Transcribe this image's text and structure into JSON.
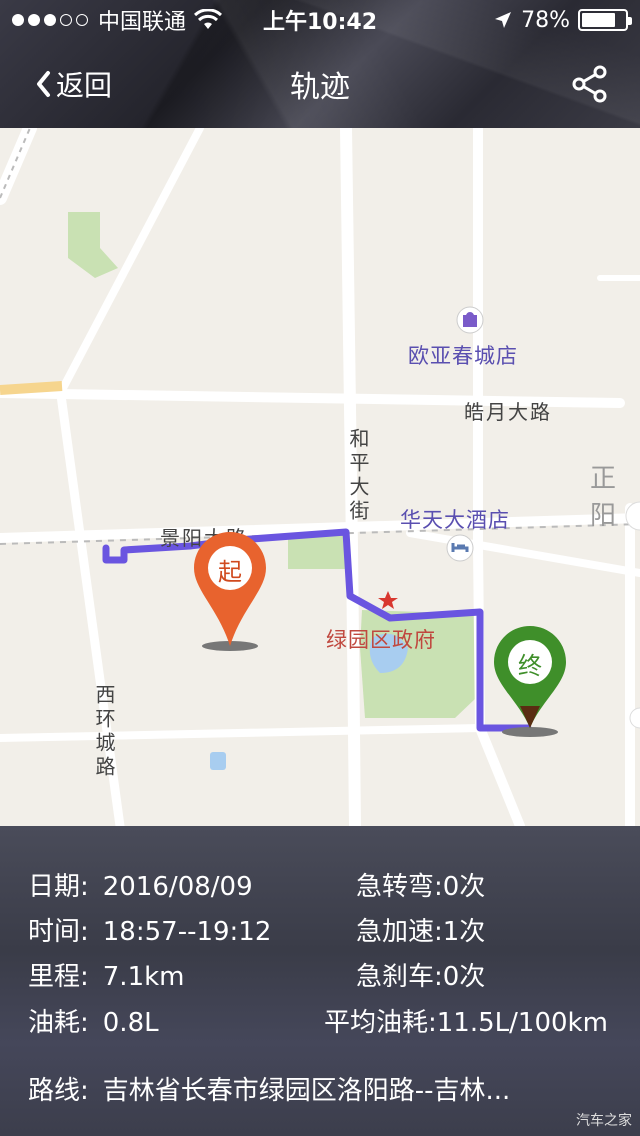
{
  "status_bar": {
    "carrier": "中国联通",
    "time": "上午10:42",
    "battery_percent": "78%",
    "battery_level": 0.78
  },
  "nav": {
    "back_label": "返回",
    "title": "轨迹"
  },
  "map": {
    "roads": {
      "jingyang": "景阳大路",
      "haoyue": "皓月大路",
      "heping": "和平大街",
      "xihuan": "西环城路"
    },
    "pois": {
      "ouya": "欧亚春城店",
      "huatian": "华天大酒店",
      "lvyuan": "绿园区政府",
      "zhengyang": "正阳"
    },
    "start_marker": "起",
    "end_marker": "终",
    "route_color": "#6a55e0",
    "start_color": "#e8632e",
    "end_color": "#3f8f2a"
  },
  "trip": {
    "date_label": "日期:",
    "date_value": "2016/08/09",
    "time_label": "时间:",
    "time_value": "18:57--19:12",
    "distance_label": "里程:",
    "distance_value": "7.1km",
    "fuel_label": "油耗:",
    "fuel_value": "0.8L",
    "sharp_turn_label": "急转弯:",
    "sharp_turn_value": "0次",
    "accel_label": "急加速:",
    "accel_value": "1次",
    "brake_label": "急刹车:",
    "brake_value": "0次",
    "avg_fuel_label": "平均油耗:",
    "avg_fuel_value": "11.5L/100km",
    "route_label": "路线:",
    "route_value": "吉林省长春市绿园区洛阳路--吉林..."
  },
  "watermark": "汽车之家"
}
